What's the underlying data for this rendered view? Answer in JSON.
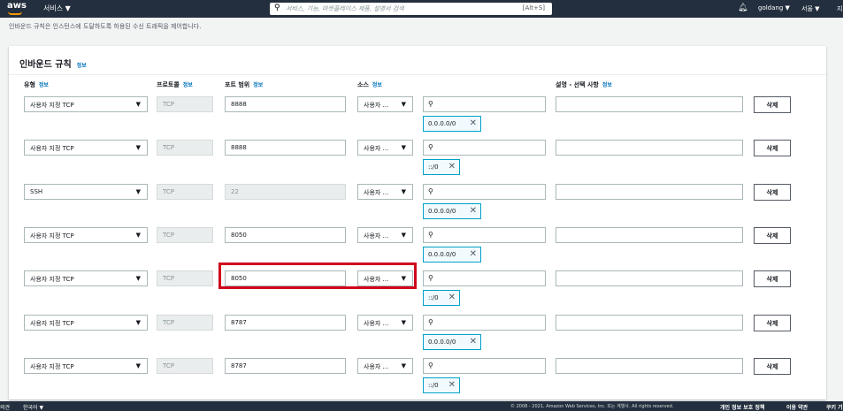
{
  "topbar": {
    "logo": "aws",
    "services_label": "서비스 ▼",
    "search_placeholder": "서비스, 기능, 마켓플레이스 제품, 설명서 검색",
    "search_shortcut": "[Alt+S]",
    "user_label": "goldang ▼",
    "region_label": "서울 ▼",
    "support_label": "지"
  },
  "description": "인바운드 규칙은 인스턴스에 도달하도록 허용된 수신 트래픽을 제어합니다.",
  "panel": {
    "title": "인바운드 규칙",
    "info": "정보",
    "columns": {
      "type": "유형",
      "protocol": "프로토콜",
      "port": "포트 범위",
      "source": "소스",
      "description": "설명 - 선택 사항",
      "info": "정보"
    },
    "rules": [
      {
        "type": "사용자 지정 TCP",
        "protocol": "TCP",
        "port": "8888",
        "source": "사용자 ...",
        "cidr": "0.0.0.0/0",
        "delete": "삭제"
      },
      {
        "type": "사용자 지정 TCP",
        "protocol": "TCP",
        "port": "8888",
        "source": "사용자 ...",
        "cidr": "::/0",
        "delete": "삭제"
      },
      {
        "type": "SSH",
        "protocol": "TCP",
        "port": "22",
        "source": "사용자 ...",
        "cidr": "0.0.0.0/0",
        "delete": "삭제"
      },
      {
        "type": "사용자 지정 TCP",
        "protocol": "TCP",
        "port": "8050",
        "source": "사용자 ...",
        "cidr": "0.0.0.0/0",
        "delete": "삭제"
      },
      {
        "type": "사용자 지정 TCP",
        "protocol": "TCP",
        "port": "8050",
        "source": "사용자 ...",
        "cidr": "::/0",
        "delete": "삭제"
      },
      {
        "type": "사용자 지정 TCP",
        "protocol": "TCP",
        "port": "8787",
        "source": "사용자 ...",
        "cidr": "0.0.0.0/0",
        "delete": "삭제"
      },
      {
        "type": "사용자 지정 TCP",
        "protocol": "TCP",
        "port": "8787",
        "source": "사용자 ...",
        "cidr": "::/0",
        "delete": "삭제"
      }
    ]
  },
  "footer": {
    "feedback": "의견",
    "language": "한국어 ▼",
    "copyright": "© 2008 - 2021, Amazon Web Services, Inc. 또는 계열사. All rights reserved.",
    "privacy": "개인 정보 보호 정책",
    "terms": "이용 약관",
    "cookie": "쿠키 기"
  },
  "colors": {
    "topbar": "#232f3e",
    "accent": "#ff9900",
    "link": "#0073bb",
    "highlight": "#d0021b",
    "chip_border": "#00a1c9"
  }
}
